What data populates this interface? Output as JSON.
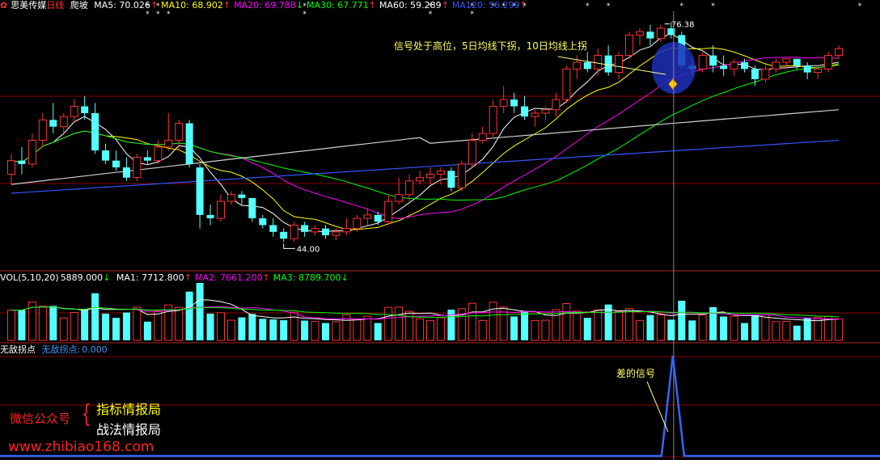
{
  "header": {
    "stock_name": "思美传媒",
    "period": "日线",
    "formula": "爬坡",
    "ma": [
      {
        "label": "MA5:",
        "value": "70.026",
        "arrow": "↑",
        "color": "#ffffff"
      },
      {
        "label": "MA10:",
        "value": "68.902",
        "arrow": "↑",
        "color": "#ffff00"
      },
      {
        "label": "MA20:",
        "value": "69.788",
        "arrow": "↓",
        "color": "#ff00ff"
      },
      {
        "label": "MA30:",
        "value": "67.771",
        "arrow": "↑",
        "color": "#00ff00"
      },
      {
        "label": "MA60:",
        "value": "59.289",
        "arrow": "↑",
        "color": "#ffffff"
      },
      {
        "label": "MA120:",
        "value": "56.299",
        "arrow": "↑",
        "color": "#3355ff"
      }
    ]
  },
  "vol_header": {
    "label": "VOL(5,10,20)",
    "value": "5889.000",
    "arrow": "↓",
    "ma": [
      {
        "label": "MA1:",
        "value": "7712.800",
        "arrow": "↑",
        "color": "#ffffff"
      },
      {
        "label": "MA2:",
        "value": "7661.200",
        "arrow": "↑",
        "color": "#ff00ff"
      },
      {
        "label": "MA3:",
        "value": "8789.700",
        "arrow": "↓",
        "color": "#00ff00"
      }
    ]
  },
  "ind_header": {
    "name": "无敌拐点",
    "line_label": "无敌拐点:",
    "value": "0.000"
  },
  "annotations": {
    "high": "76.38",
    "low": "44.00",
    "signal_text": "信号处于高位，5日均线下拐，10日均线上拐",
    "bad_signal": "差的信号"
  },
  "watermark": {
    "wechat": "微信公众号",
    "brace": "{",
    "line1": "指标情报局",
    "line2": "战法情报局",
    "url": "www.zhibiao168.com"
  },
  "colors": {
    "up": "#ff3232",
    "down": "#54ffff",
    "grid": "#8b0000",
    "ma5": "#ffffff",
    "ma10": "#ffff00",
    "ma20": "#ff00ff",
    "ma30": "#00ff00",
    "ma60": "#ffffff",
    "ma120": "#3355ff",
    "signal": "#3366ff"
  },
  "chart_data": {
    "type": "candlestick",
    "ohlc": [
      [
        54,
        57,
        52.5,
        56
      ],
      [
        56,
        58,
        54,
        55.5
      ],
      [
        55.5,
        60,
        55,
        59
      ],
      [
        59,
        63,
        58,
        62
      ],
      [
        62,
        64.5,
        60,
        61
      ],
      [
        61,
        63,
        60,
        62.5
      ],
      [
        62.5,
        65,
        61.5,
        64
      ],
      [
        64,
        65.5,
        62,
        63
      ],
      [
        63,
        64.5,
        57,
        57.5
      ],
      [
        57.5,
        58.5,
        55.5,
        56
      ],
      [
        56,
        57.5,
        54.5,
        55
      ],
      [
        55,
        56.5,
        53,
        53.5
      ],
      [
        53.5,
        57,
        53,
        56.5
      ],
      [
        56.5,
        57.5,
        55.5,
        56
      ],
      [
        56,
        59,
        55.5,
        58
      ],
      [
        58,
        63,
        57.5,
        59
      ],
      [
        59,
        62,
        57.5,
        61.5
      ],
      [
        61.5,
        62,
        55,
        55.5
      ],
      [
        55,
        55.5,
        46,
        48
      ],
      [
        48,
        49.5,
        46.5,
        47.5
      ],
      [
        47.5,
        51,
        47,
        50
      ],
      [
        50,
        51.5,
        49.5,
        51
      ],
      [
        51,
        51.5,
        49.5,
        50.5
      ],
      [
        50.5,
        50.5,
        47,
        47.5
      ],
      [
        47.5,
        48,
        46,
        46.5
      ],
      [
        46.5,
        47.5,
        44.8,
        45.5
      ],
      [
        45.5,
        46,
        44,
        44.5
      ],
      [
        44.5,
        47,
        44,
        46.5
      ],
      [
        46.5,
        47,
        44.8,
        45.5
      ],
      [
        45.5,
        46.5,
        45,
        46
      ],
      [
        46,
        46.5,
        44.5,
        45
      ],
      [
        45,
        46,
        44.3,
        45.5
      ],
      [
        45.5,
        47.5,
        45,
        46
      ],
      [
        46,
        48,
        45.5,
        47.5
      ],
      [
        47.5,
        49,
        46.5,
        48
      ],
      [
        48,
        48.5,
        46.5,
        47
      ],
      [
        47,
        51,
        46.5,
        50
      ],
      [
        50,
        53.5,
        49.5,
        51
      ],
      [
        51,
        54,
        50,
        53
      ],
      [
        53,
        54.5,
        52.5,
        53.5
      ],
      [
        53.5,
        55,
        52.5,
        54
      ],
      [
        54,
        55,
        52.5,
        54.5
      ],
      [
        54.5,
        55,
        51.5,
        52
      ],
      [
        52,
        56,
        51.5,
        55.5
      ],
      [
        55.5,
        60,
        55,
        59
      ],
      [
        59,
        61,
        58.5,
        60
      ],
      [
        60,
        65,
        59.5,
        64
      ],
      [
        64,
        67,
        63,
        65
      ],
      [
        65,
        66,
        63,
        64
      ],
      [
        64,
        65.5,
        62,
        62.5
      ],
      [
        62.5,
        63.5,
        61,
        63
      ],
      [
        63,
        64,
        62,
        63.5
      ],
      [
        63.5,
        66,
        62.5,
        65
      ],
      [
        65,
        70,
        64.5,
        69.5
      ],
      [
        69.5,
        71.5,
        68,
        70.5
      ],
      [
        70.5,
        72,
        69,
        69.5
      ],
      [
        69.5,
        72.5,
        68.5,
        71.5
      ],
      [
        71.5,
        73,
        68.5,
        69
      ],
      [
        69,
        72,
        68,
        71.5
      ],
      [
        71.5,
        75,
        71,
        74.5
      ],
      [
        74.5,
        75.5,
        73,
        75
      ],
      [
        75,
        76,
        73,
        74
      ],
      [
        74,
        76,
        73.5,
        75.5
      ],
      [
        75.5,
        76.38,
        74,
        74.5
      ],
      [
        74.5,
        75,
        69.5,
        70
      ],
      [
        70,
        71,
        68.5,
        69.5
      ],
      [
        69.5,
        72,
        69,
        71.5
      ],
      [
        71.5,
        73,
        69,
        70
      ],
      [
        70,
        71.5,
        68.5,
        69.5
      ],
      [
        69.5,
        71,
        68.5,
        70.5
      ],
      [
        70.5,
        71,
        69,
        69.5
      ],
      [
        69.5,
        70,
        67,
        68
      ],
      [
        68,
        70,
        67.5,
        69.5
      ],
      [
        69.5,
        71,
        69,
        70.5
      ],
      [
        70.5,
        71,
        69.5,
        71
      ],
      [
        71,
        71,
        69.5,
        70
      ],
      [
        70,
        70.5,
        68,
        69
      ],
      [
        69,
        70,
        68,
        69.5
      ],
      [
        69.5,
        72,
        69,
        71.5
      ],
      [
        71.5,
        73,
        71,
        72.5
      ]
    ],
    "ma_series": [
      "MA5",
      "MA10",
      "MA20",
      "MA30",
      "MA60",
      "MA120"
    ],
    "signal": {
      "name": "无敌拐点",
      "peak_value": 1,
      "peak_index": 63
    },
    "price_high": 76.38,
    "price_low": 44.0
  }
}
